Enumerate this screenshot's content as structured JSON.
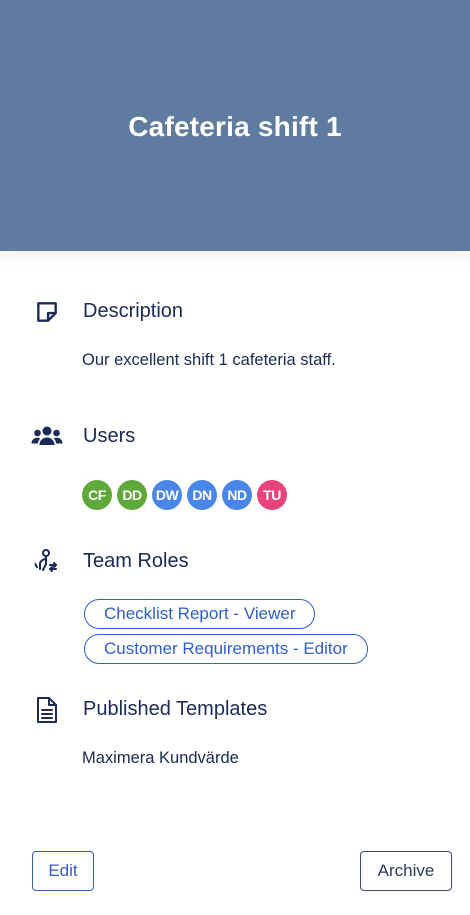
{
  "header": {
    "title": "Cafeteria shift 1",
    "background_color": "#5f7ba0"
  },
  "description": {
    "icon": "sticky-note-icon",
    "title": "Description",
    "text": "Our excellent shift 1 cafeteria staff."
  },
  "users": {
    "icon": "users-icon",
    "title": "Users",
    "avatars": [
      {
        "initials": "CF",
        "color": "#5fa83a"
      },
      {
        "initials": "DD",
        "color": "#5fa83a"
      },
      {
        "initials": "DW",
        "color": "#4a86e8"
      },
      {
        "initials": "DN",
        "color": "#4a86e8"
      },
      {
        "initials": "ND",
        "color": "#4a86e8"
      },
      {
        "initials": "TU",
        "color": "#e8437a"
      }
    ]
  },
  "team_roles": {
    "icon": "team-roles-icon",
    "title": "Team Roles",
    "roles": [
      "Checklist Report - Viewer",
      "Customer Requirements - Editor"
    ]
  },
  "published_templates": {
    "icon": "document-icon",
    "title": "Published Templates",
    "items": [
      "Maximera Kundvärde"
    ]
  },
  "actions": {
    "edit_label": "Edit",
    "archive_label": "Archive"
  }
}
